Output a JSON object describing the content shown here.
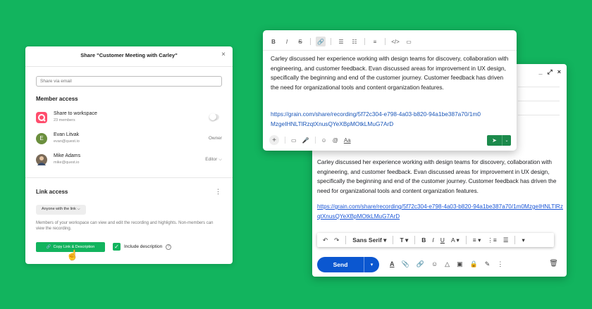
{
  "share": {
    "title": "Share \"Customer Meeting with Carley\"",
    "close_icon": "×",
    "email_placeholder": "Share via email",
    "member_access_heading": "Member access",
    "members": [
      {
        "name": "Share to workspace",
        "sub": "23 members",
        "role": "",
        "avatar_color": "#ff4d6d"
      },
      {
        "name": "Evan Litvak",
        "sub": "evan@quest.io",
        "role": "Owner",
        "initial": "E",
        "avatar_color": "#6b8f3e"
      },
      {
        "name": "Mike Adams",
        "sub": "mike@quest.io",
        "role": "Editor ⌵",
        "avatar_color": "#7a6a58"
      }
    ],
    "link_access_heading": "Link access",
    "link_access_more": "⋮",
    "link_dropdown": "Anyone with the link ⌵",
    "link_description": "Members of your workspace can view and edit the recording and highlights. Non-members can view the recording.",
    "copy_button": "Copy Link & Description",
    "include_description": "Include description",
    "accent": "#12b45e"
  },
  "editor": {
    "toolbar": [
      "B",
      "I",
      "S",
      "🔗",
      "☰",
      "☷",
      "≡",
      "</>",
      "▭"
    ],
    "body": "Carley discussed her experience working with design teams for discovery, collaboration with engineering, and customer feedback. Evan discussed areas for improvement in UX design, specifically the beginning and end of the customer journey. Customer feedback has driven the need for organizational tools and content organization features.",
    "link": "https://grain.com/share/recording/5f72c304-e798-4a03-b820-94a1be387a70/1m0MzgeIHNLTlRzqtXnusQYeXBpMOtkLMuG7ArD",
    "bottom_icons": [
      "+",
      "▭",
      "🎤",
      "☺",
      "@",
      "Aa"
    ],
    "send_icon": "➤",
    "send_dropdown": "⌄"
  },
  "gmail": {
    "window_controls": [
      "_",
      "⤢",
      "×"
    ],
    "body": "Carley discussed her experience working with design teams for discovery, collaboration with engineering, and customer feedback. Evan discussed areas for improvement in UX design, specifically the beginning and end of the customer journey. Customer feedback has driven the need for organizational tools and content organization features.",
    "link": "https://grain.com/share/recording/5f72c304-e798-4a03-b820-94a1be387a70/1m0MzgeIHNLTlRzqtXnusQYeXBpMOtkLMuG7ArD",
    "format_bar": {
      "undo": "↶",
      "redo": "↷",
      "font": "Sans Serif ▾",
      "size": "T ▾",
      "bold": "B",
      "italic": "I",
      "underline": "U",
      "color": "A ▾",
      "align": "≡ ▾",
      "numbered": "⋮≡",
      "bulleted": "☰",
      "more": "▾"
    },
    "send": "Send",
    "send_dropdown": "▾",
    "tools": [
      "A",
      "📎",
      "🔗",
      "☺",
      "△",
      "▣",
      "🔒",
      "✎",
      "⋮"
    ],
    "trash": "🗑"
  }
}
